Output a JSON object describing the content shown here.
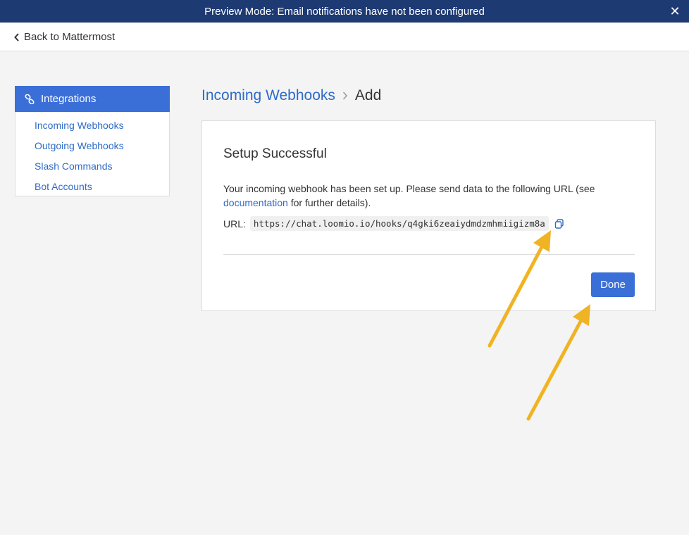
{
  "banner": {
    "text": "Preview Mode: Email notifications have not been configured",
    "close_icon": "close-icon",
    "background": "#1e3a73"
  },
  "nav": {
    "back_label": "Back to Mattermost"
  },
  "sidebar": {
    "header": "Integrations",
    "header_icon": "link-icon",
    "accent": "#3b6fd8",
    "items": [
      {
        "label": "Incoming Webhooks"
      },
      {
        "label": "Outgoing Webhooks"
      },
      {
        "label": "Slash Commands"
      },
      {
        "label": "Bot Accounts"
      }
    ]
  },
  "breadcrumb": {
    "parent": "Incoming Webhooks",
    "current": "Add"
  },
  "card": {
    "title": "Setup Successful",
    "text_before": "Your incoming webhook has been set up. Please send data to the following URL (see ",
    "link_text": "documentation",
    "text_after": " for further details).",
    "url_label": "URL:",
    "url_value": "https://chat.loomio.io/hooks/q4gki6zeaiydmdzmhmiigizm8a",
    "copy_icon": "copy-icon",
    "done_label": "Done"
  },
  "annotation_color": "#f0b323"
}
